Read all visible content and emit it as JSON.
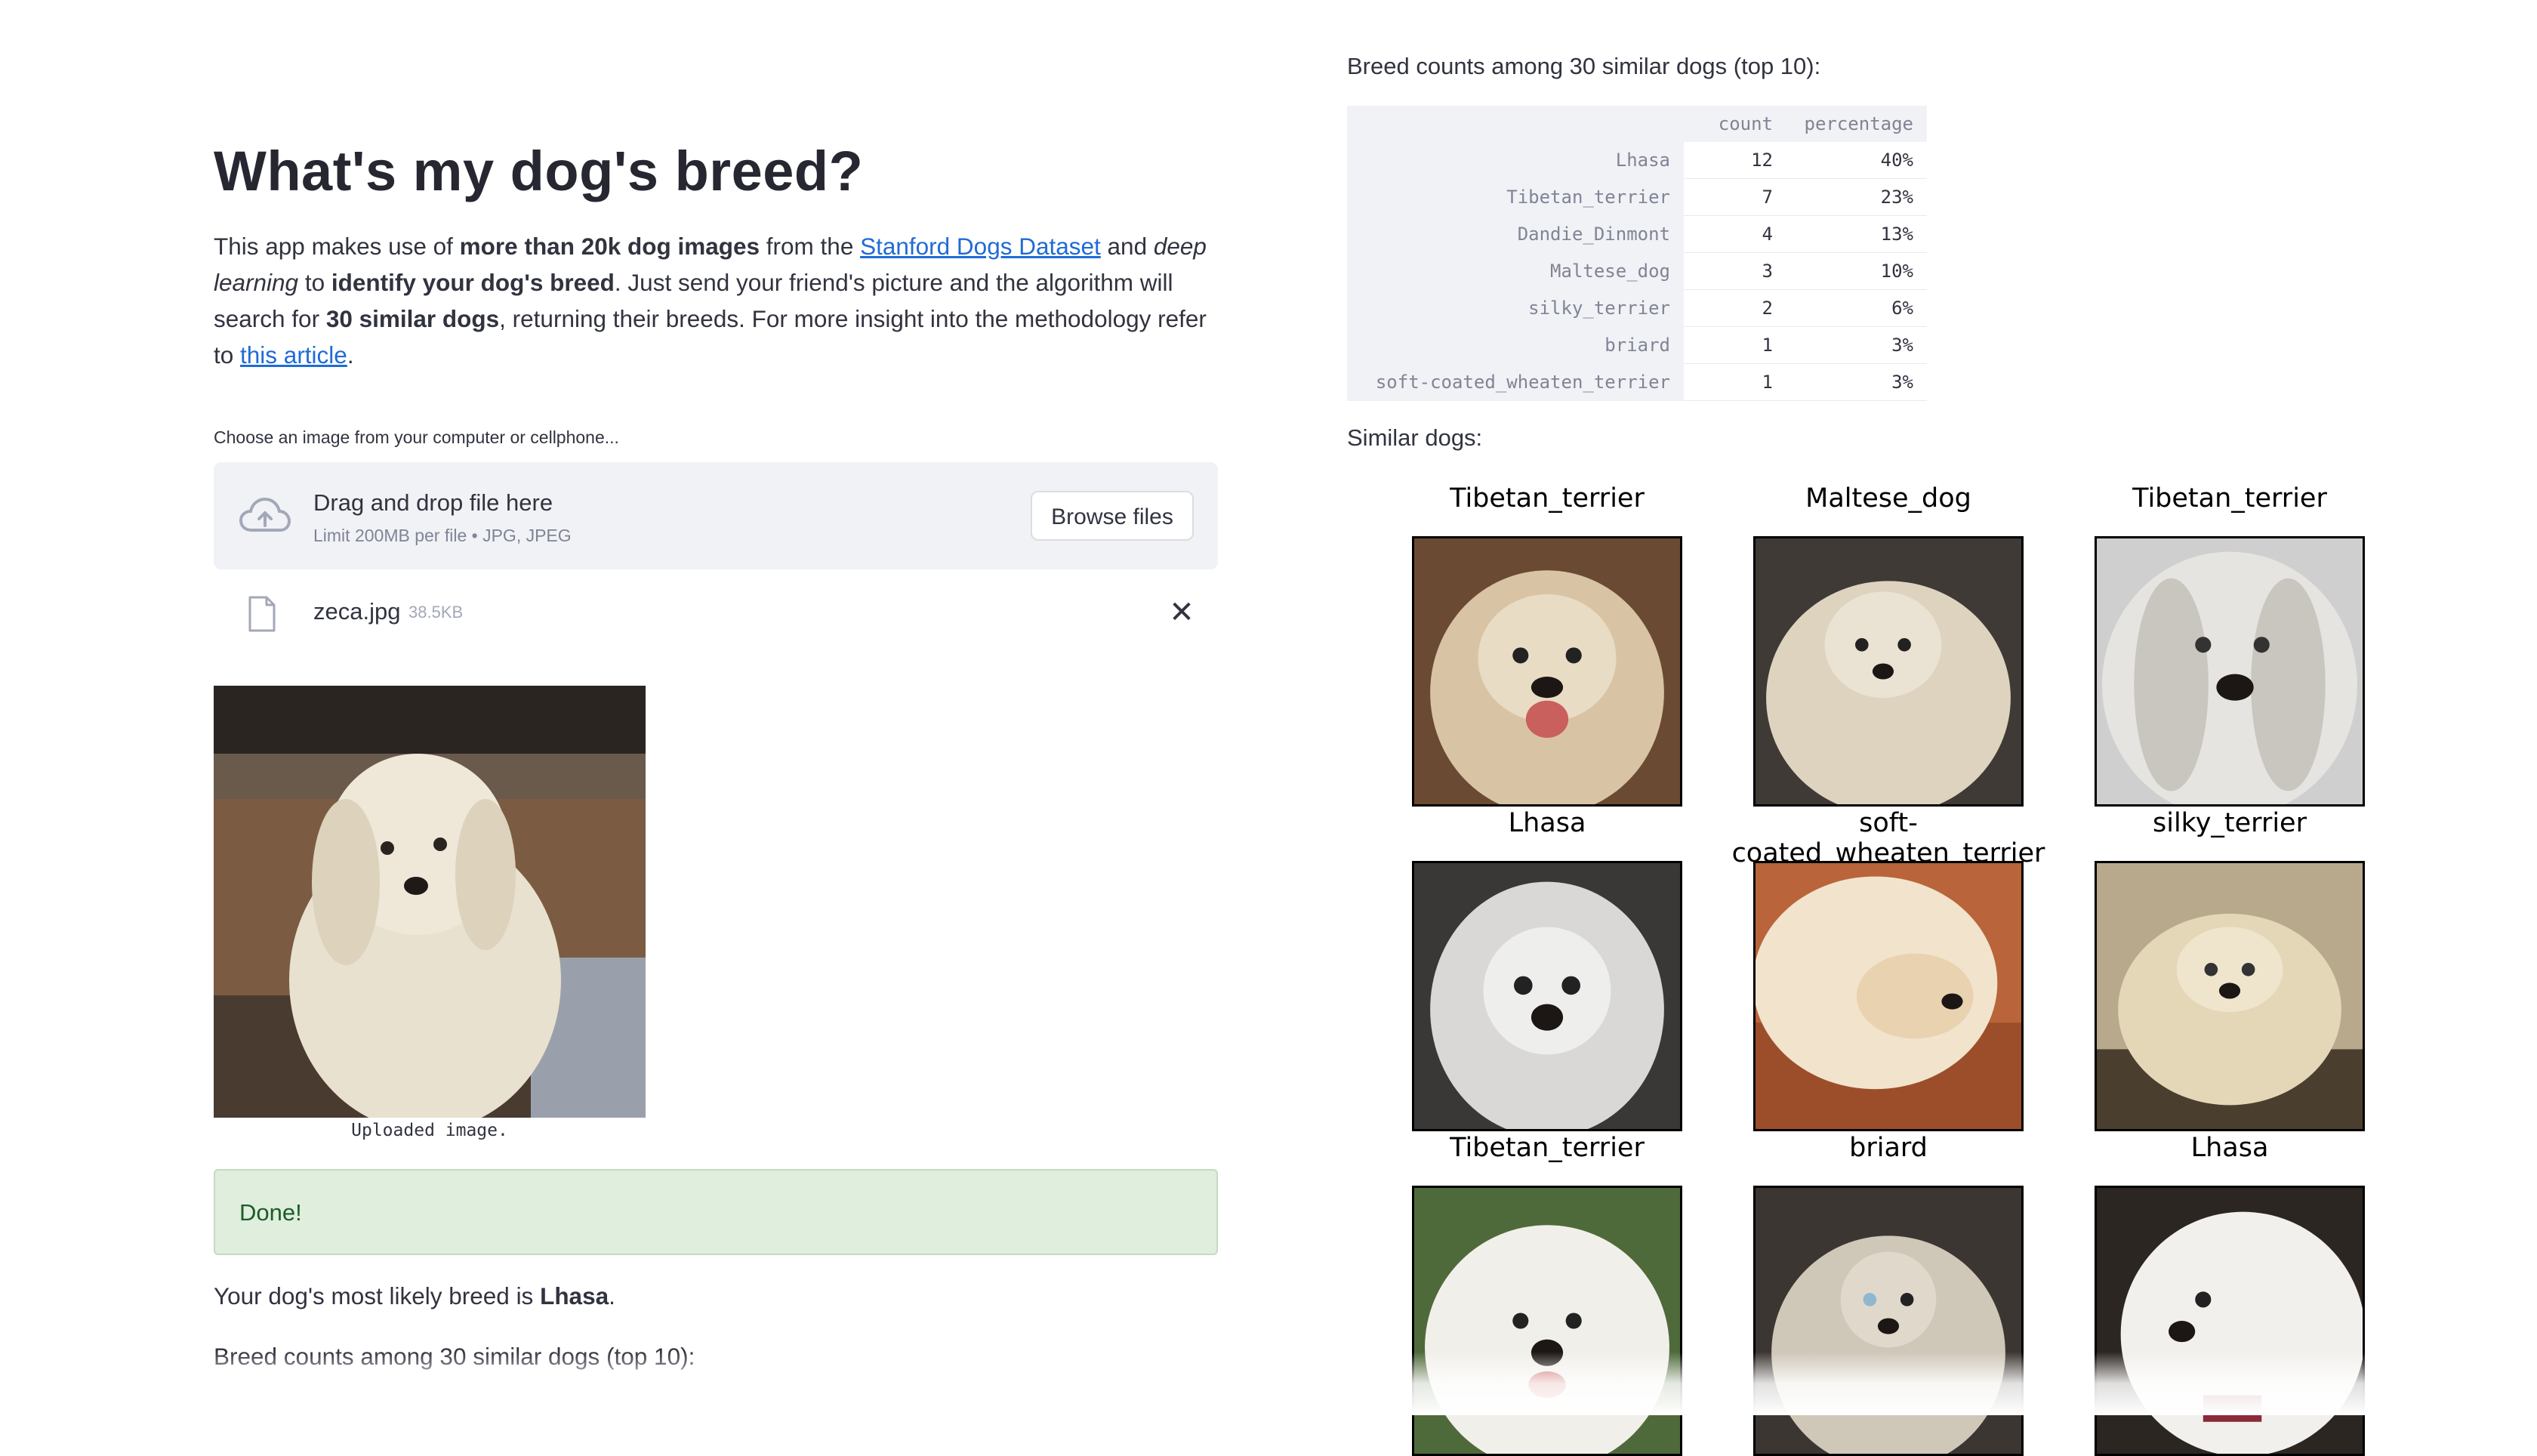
{
  "app": {
    "title": "What's my dog's breed?",
    "intro": {
      "t1": "This app makes use of ",
      "b1": "more than 20k dog images",
      "t2": " from the ",
      "link1": "Stanford Dogs Dataset",
      "t3": " and ",
      "i1": "deep learning",
      "t4": " to ",
      "b2": "identify your dog's breed",
      "t5": ". Just send your friend's picture and the algorithm will search for ",
      "b3": "30 similar dogs",
      "t6": ", returning their breeds. For more insight into the methodology refer to ",
      "link2": "this article",
      "t7": "."
    }
  },
  "uploader": {
    "label": "Choose an image from your computer or cellphone...",
    "drag_text": "Drag and drop file here",
    "limit_text": "Limit 200MB per file • JPG, JPEG",
    "browse_label": "Browse files",
    "file": {
      "name": "zeca.jpg",
      "size": "38.5KB"
    },
    "icons": {
      "upload": "cloud-upload-icon",
      "file": "file-icon",
      "close": "close-icon"
    }
  },
  "uploaded_image": {
    "caption": "Uploaded image."
  },
  "status": {
    "message": "Done!"
  },
  "result": {
    "prefix": "Your dog's most likely breed is ",
    "breed": "Lhasa",
    "suffix": "."
  },
  "breed_counts": {
    "heading": "Breed counts among 30 similar dogs (top 10):",
    "columns": [
      "count",
      "percentage"
    ],
    "rows": [
      {
        "breed": "Lhasa",
        "count": "12",
        "percentage": "40%"
      },
      {
        "breed": "Tibetan_terrier",
        "count": "7",
        "percentage": "23%"
      },
      {
        "breed": "Dandie_Dinmont",
        "count": "4",
        "percentage": "13%"
      },
      {
        "breed": "Maltese_dog",
        "count": "3",
        "percentage": "10%"
      },
      {
        "breed": "silky_terrier",
        "count": "2",
        "percentage": "6%"
      },
      {
        "breed": "briard",
        "count": "1",
        "percentage": "3%"
      },
      {
        "breed": "soft-coated_wheaten_terrier",
        "count": "1",
        "percentage": "3%"
      }
    ]
  },
  "similar_dogs": {
    "label": "Similar dogs:",
    "items": [
      {
        "breed": "Tibetan_terrier"
      },
      {
        "breed": "Maltese_dog"
      },
      {
        "breed": "Tibetan_terrier"
      },
      {
        "breed": "Lhasa"
      },
      {
        "breed": "soft-coated_wheaten_terrier"
      },
      {
        "breed": "silky_terrier"
      },
      {
        "breed": "Tibetan_terrier"
      },
      {
        "breed": "briard"
      },
      {
        "breed": "Lhasa"
      }
    ]
  },
  "colors": {
    "link": "#1f6bd6",
    "success_bg": "#dfeedd",
    "success_text": "#1d5c2a",
    "dropzone_bg": "#f0f2f6"
  }
}
